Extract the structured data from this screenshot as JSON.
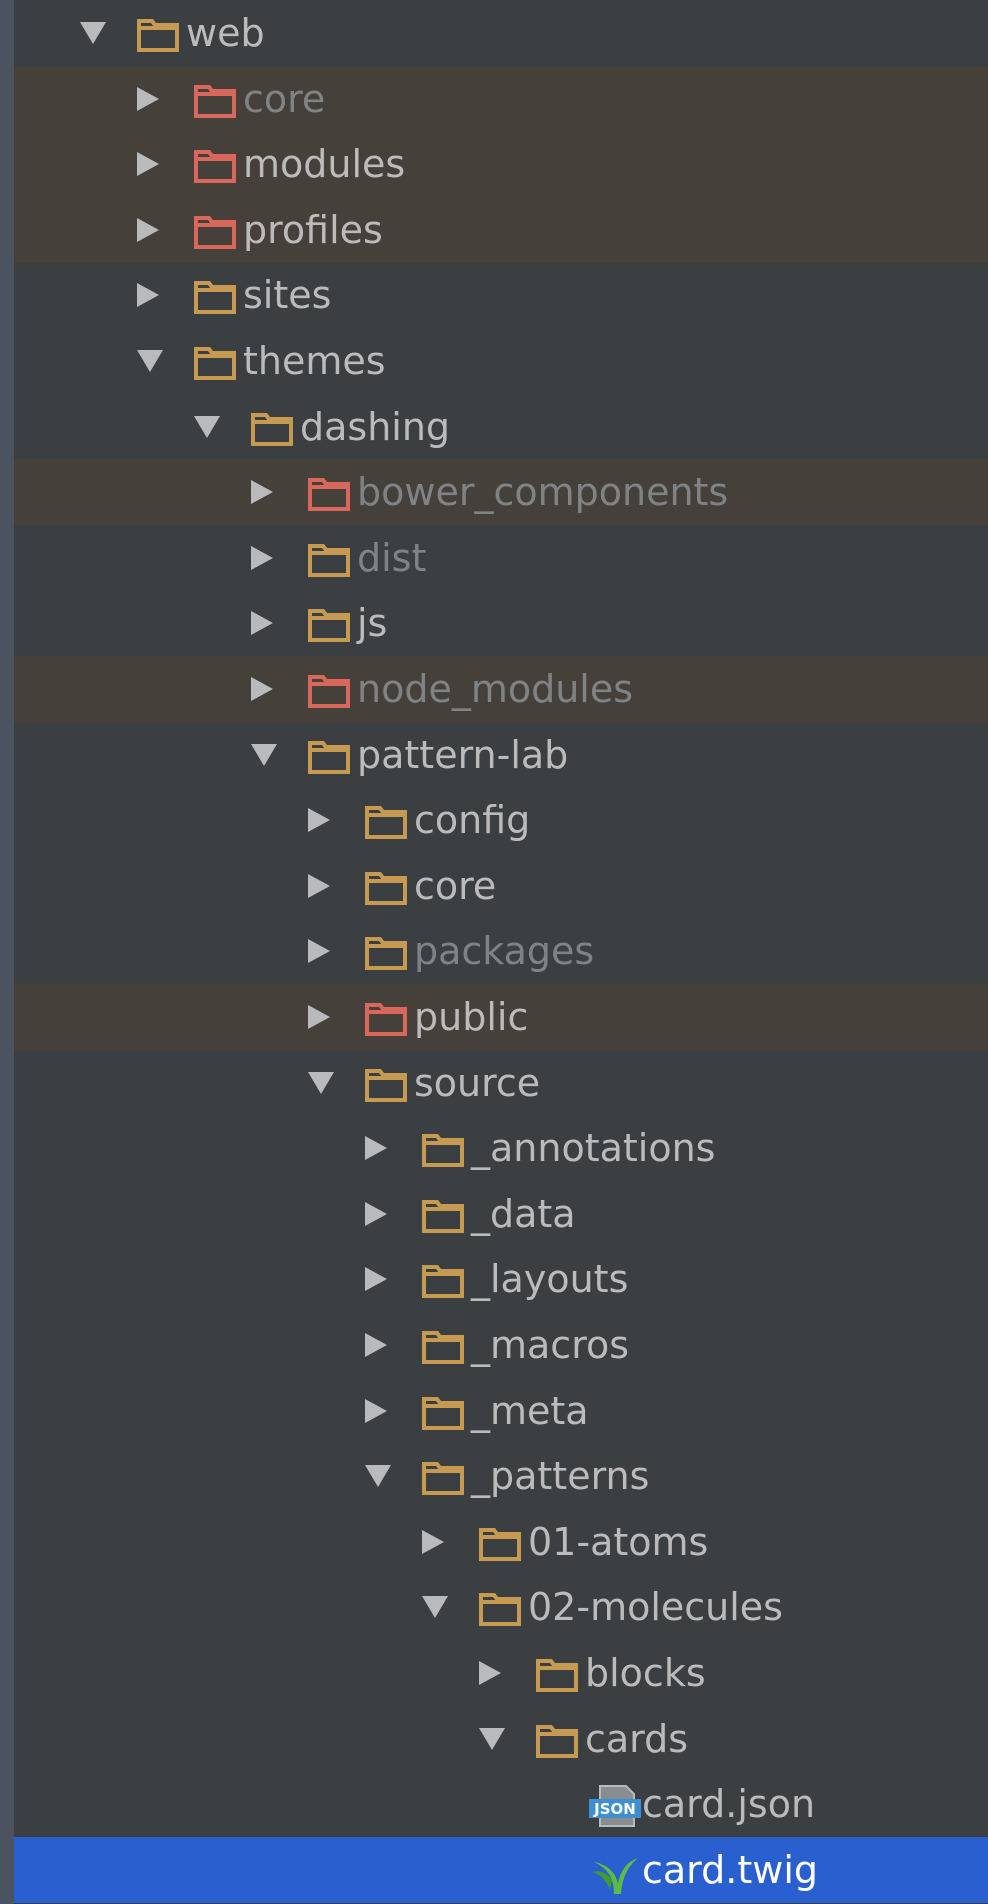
{
  "tree": {
    "rows": [
      {
        "label": "web",
        "depth": 0,
        "state": "expanded",
        "icon": "folder-icon",
        "icon_color": "#c79a51",
        "text_style": "normal",
        "excluded": false
      },
      {
        "label": "core",
        "depth": 1,
        "state": "collapsed",
        "icon": "folder-icon",
        "icon_color": "#d9675c",
        "text_style": "dim",
        "excluded": true
      },
      {
        "label": "modules",
        "depth": 1,
        "state": "collapsed",
        "icon": "folder-icon",
        "icon_color": "#d9675c",
        "text_style": "normal",
        "excluded": true
      },
      {
        "label": "profiles",
        "depth": 1,
        "state": "collapsed",
        "icon": "folder-icon",
        "icon_color": "#d9675c",
        "text_style": "normal",
        "excluded": true
      },
      {
        "label": "sites",
        "depth": 1,
        "state": "collapsed",
        "icon": "folder-icon",
        "icon_color": "#c79a51",
        "text_style": "normal",
        "excluded": false
      },
      {
        "label": "themes",
        "depth": 1,
        "state": "expanded",
        "icon": "folder-icon",
        "icon_color": "#c79a51",
        "text_style": "normal",
        "excluded": false
      },
      {
        "label": "dashing",
        "depth": 2,
        "state": "expanded",
        "icon": "folder-icon",
        "icon_color": "#c79a51",
        "text_style": "normal",
        "excluded": false
      },
      {
        "label": "bower_components",
        "depth": 3,
        "state": "collapsed",
        "icon": "folder-icon",
        "icon_color": "#d9675c",
        "text_style": "dim",
        "excluded": true
      },
      {
        "label": "dist",
        "depth": 3,
        "state": "collapsed",
        "icon": "folder-icon",
        "icon_color": "#c79a51",
        "text_style": "dim",
        "excluded": false
      },
      {
        "label": "js",
        "depth": 3,
        "state": "collapsed",
        "icon": "folder-icon",
        "icon_color": "#c79a51",
        "text_style": "normal",
        "excluded": false
      },
      {
        "label": "node_modules",
        "depth": 3,
        "state": "collapsed",
        "icon": "folder-icon",
        "icon_color": "#d9675c",
        "text_style": "dim",
        "excluded": true
      },
      {
        "label": "pattern-lab",
        "depth": 3,
        "state": "expanded",
        "icon": "folder-icon",
        "icon_color": "#c79a51",
        "text_style": "normal",
        "excluded": false
      },
      {
        "label": "config",
        "depth": 4,
        "state": "collapsed",
        "icon": "folder-icon",
        "icon_color": "#c79a51",
        "text_style": "normal",
        "excluded": false
      },
      {
        "label": "core",
        "depth": 4,
        "state": "collapsed",
        "icon": "folder-icon",
        "icon_color": "#c79a51",
        "text_style": "normal",
        "excluded": false
      },
      {
        "label": "packages",
        "depth": 4,
        "state": "collapsed",
        "icon": "folder-icon",
        "icon_color": "#c79a51",
        "text_style": "dim",
        "excluded": false
      },
      {
        "label": "public",
        "depth": 4,
        "state": "collapsed",
        "icon": "folder-icon",
        "icon_color": "#d9675c",
        "text_style": "normal",
        "excluded": true
      },
      {
        "label": "source",
        "depth": 4,
        "state": "expanded",
        "icon": "folder-icon",
        "icon_color": "#c79a51",
        "text_style": "normal",
        "excluded": false
      },
      {
        "label": "_annotations",
        "depth": 5,
        "state": "collapsed",
        "icon": "folder-icon",
        "icon_color": "#c79a51",
        "text_style": "normal",
        "excluded": false
      },
      {
        "label": "_data",
        "depth": 5,
        "state": "collapsed",
        "icon": "folder-icon",
        "icon_color": "#c79a51",
        "text_style": "normal",
        "excluded": false
      },
      {
        "label": "_layouts",
        "depth": 5,
        "state": "collapsed",
        "icon": "folder-icon",
        "icon_color": "#c79a51",
        "text_style": "normal",
        "excluded": false
      },
      {
        "label": "_macros",
        "depth": 5,
        "state": "collapsed",
        "icon": "folder-icon",
        "icon_color": "#c79a51",
        "text_style": "normal",
        "excluded": false
      },
      {
        "label": "_meta",
        "depth": 5,
        "state": "collapsed",
        "icon": "folder-icon",
        "icon_color": "#c79a51",
        "text_style": "normal",
        "excluded": false
      },
      {
        "label": "_patterns",
        "depth": 5,
        "state": "expanded",
        "icon": "folder-icon",
        "icon_color": "#c79a51",
        "text_style": "normal",
        "excluded": false
      },
      {
        "label": "01-atoms",
        "depth": 6,
        "state": "collapsed",
        "icon": "folder-icon",
        "icon_color": "#c79a51",
        "text_style": "normal",
        "excluded": false
      },
      {
        "label": "02-molecules",
        "depth": 6,
        "state": "expanded",
        "icon": "folder-icon",
        "icon_color": "#c79a51",
        "text_style": "normal",
        "excluded": false
      },
      {
        "label": "blocks",
        "depth": 7,
        "state": "collapsed",
        "icon": "folder-icon",
        "icon_color": "#c79a51",
        "text_style": "normal",
        "excluded": false
      },
      {
        "label": "cards",
        "depth": 7,
        "state": "expanded",
        "icon": "folder-icon",
        "icon_color": "#c79a51",
        "text_style": "normal",
        "excluded": false
      },
      {
        "label": "card.json",
        "depth": 8,
        "state": "leaf",
        "icon": "json-file-icon",
        "icon_badge": "JSON",
        "icon_color": "#3d8fd1",
        "text_style": "normal",
        "excluded": false
      },
      {
        "label": "card.twig",
        "depth": 8,
        "state": "leaf",
        "icon": "twig-file-icon",
        "icon_color": "#5dbb45",
        "text_style": "white",
        "excluded": false,
        "selected": true
      }
    ],
    "colors": {
      "background": "#3c3f41",
      "excluded_row": "#45403a",
      "selected_row": "#2a5fcf",
      "arrow": "#b8babb",
      "normal_text": "#bbbbbb",
      "dim_text": "#7f8385"
    }
  }
}
